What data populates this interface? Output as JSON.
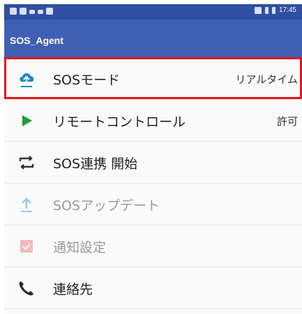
{
  "status_bar": {
    "time": "17:45"
  },
  "app_bar": {
    "title": "SOS_Agent"
  },
  "menu": [
    {
      "label": "SOSモード",
      "value": "リアルタイム",
      "icon": "cloud-upload-icon",
      "enabled": true
    },
    {
      "label": "リモートコントロール",
      "value": "許可",
      "icon": "play-icon",
      "enabled": true
    },
    {
      "label": "SOS連携 開始",
      "value": "",
      "icon": "sync-arrows-icon",
      "enabled": true
    },
    {
      "label": "SOSアップデート",
      "value": "",
      "icon": "upload-arrow-icon",
      "enabled": false
    },
    {
      "label": "通知設定",
      "value": "",
      "icon": "notification-check-icon",
      "enabled": false
    },
    {
      "label": "連絡先",
      "value": "",
      "icon": "phone-icon",
      "enabled": true
    }
  ],
  "colors": {
    "status_bar": "#304fa2",
    "app_bar": "#3f5fb4",
    "highlight_border": "#e4141b",
    "play_green": "#1e9e37",
    "cloud_blue": "#1e88c8"
  }
}
